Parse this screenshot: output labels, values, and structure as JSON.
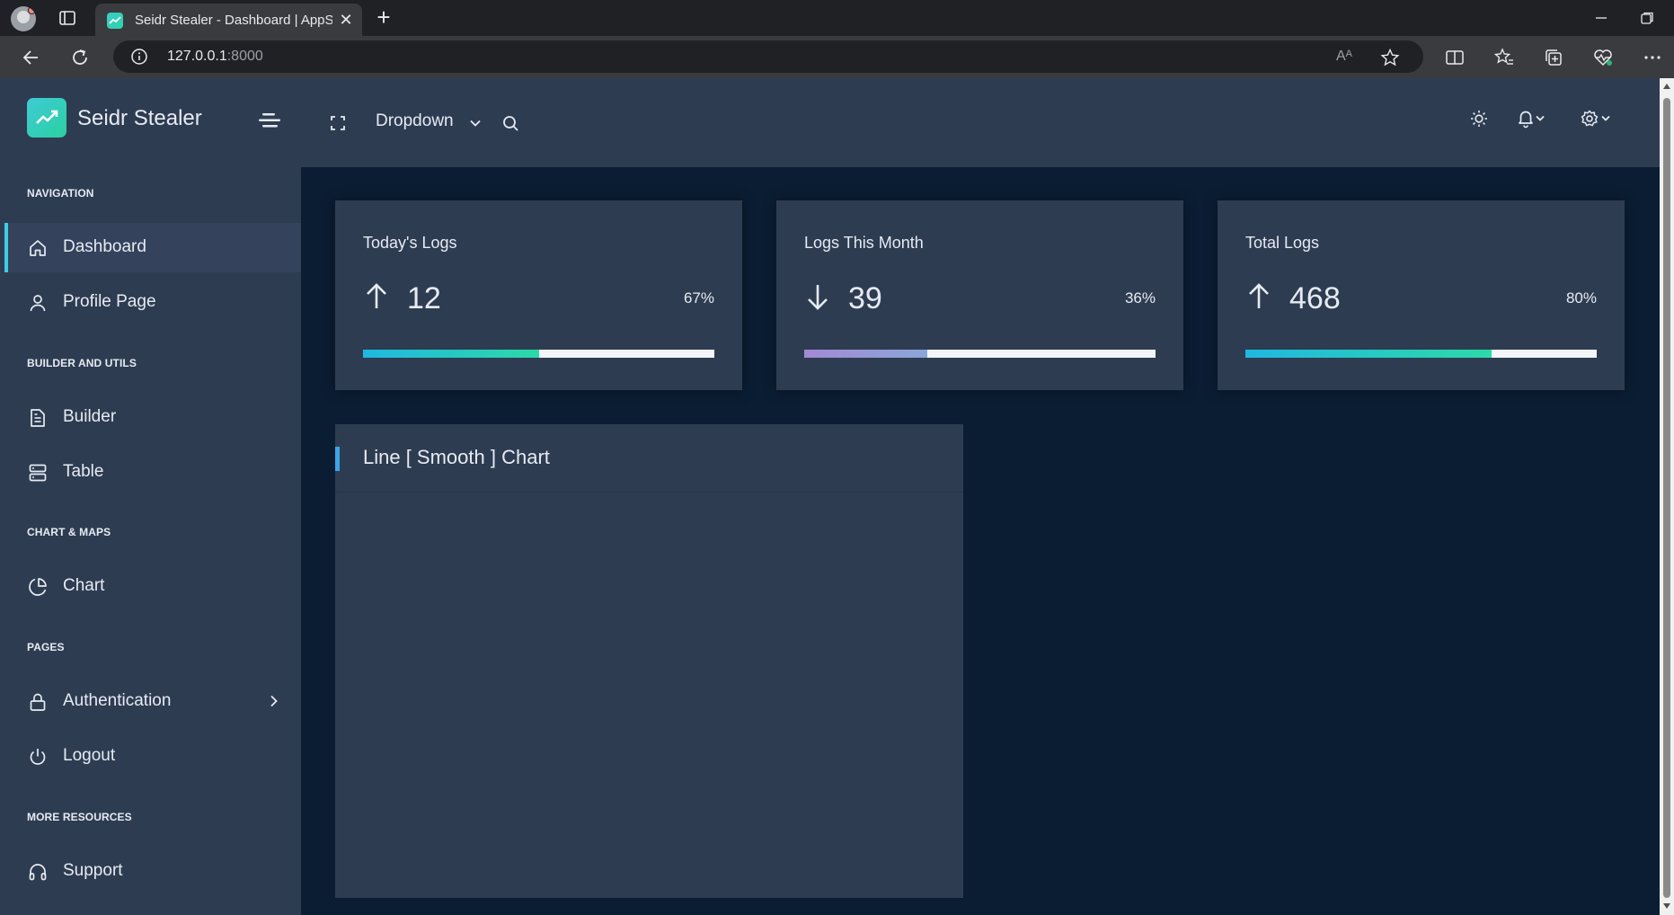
{
  "browser": {
    "tab_title": "Seidr Stealer - Dashboard | AppSeed",
    "tab_close": "✕",
    "new_tab": "+",
    "url_host": "127.0.0.1",
    "url_port": ":8000",
    "read_aloud": "Aᴬ"
  },
  "sidebar": {
    "brand": "Seidr Stealer",
    "captions": {
      "navigation": "NAVIGATION",
      "builder": "BUILDER AND UTILS",
      "chart": "CHART & MAPS",
      "pages": "PAGES",
      "resources": "MORE RESOURCES"
    },
    "items": {
      "dashboard": "Dashboard",
      "profile": "Profile Page",
      "builder": "Builder",
      "table": "Table",
      "chart": "Chart",
      "authentication": "Authentication",
      "logout": "Logout",
      "support": "Support"
    }
  },
  "header": {
    "dropdown": "Dropdown"
  },
  "stats": [
    {
      "title": "Today's Logs",
      "value": "12",
      "direction": "up",
      "percent": "67%",
      "progress": 0.5,
      "color_from": "#1fb8e0",
      "color_to": "#2dd9a8"
    },
    {
      "title": "Logs This Month",
      "value": "39",
      "direction": "down",
      "percent": "36%",
      "progress": 0.35,
      "color_from": "#a389d4",
      "color_to": "#8aa7d8"
    },
    {
      "title": "Total Logs",
      "value": "468",
      "direction": "up",
      "percent": "80%",
      "progress": 0.7,
      "color_from": "#1fb8e0",
      "color_to": "#2dd9a8"
    }
  ],
  "chart_panel": {
    "title": "Line [ Smooth ] Chart"
  },
  "colors": {
    "sidebar_bg": "#2e3c52",
    "content_bg": "#0b1d33",
    "accent": "#3ecbe6"
  }
}
